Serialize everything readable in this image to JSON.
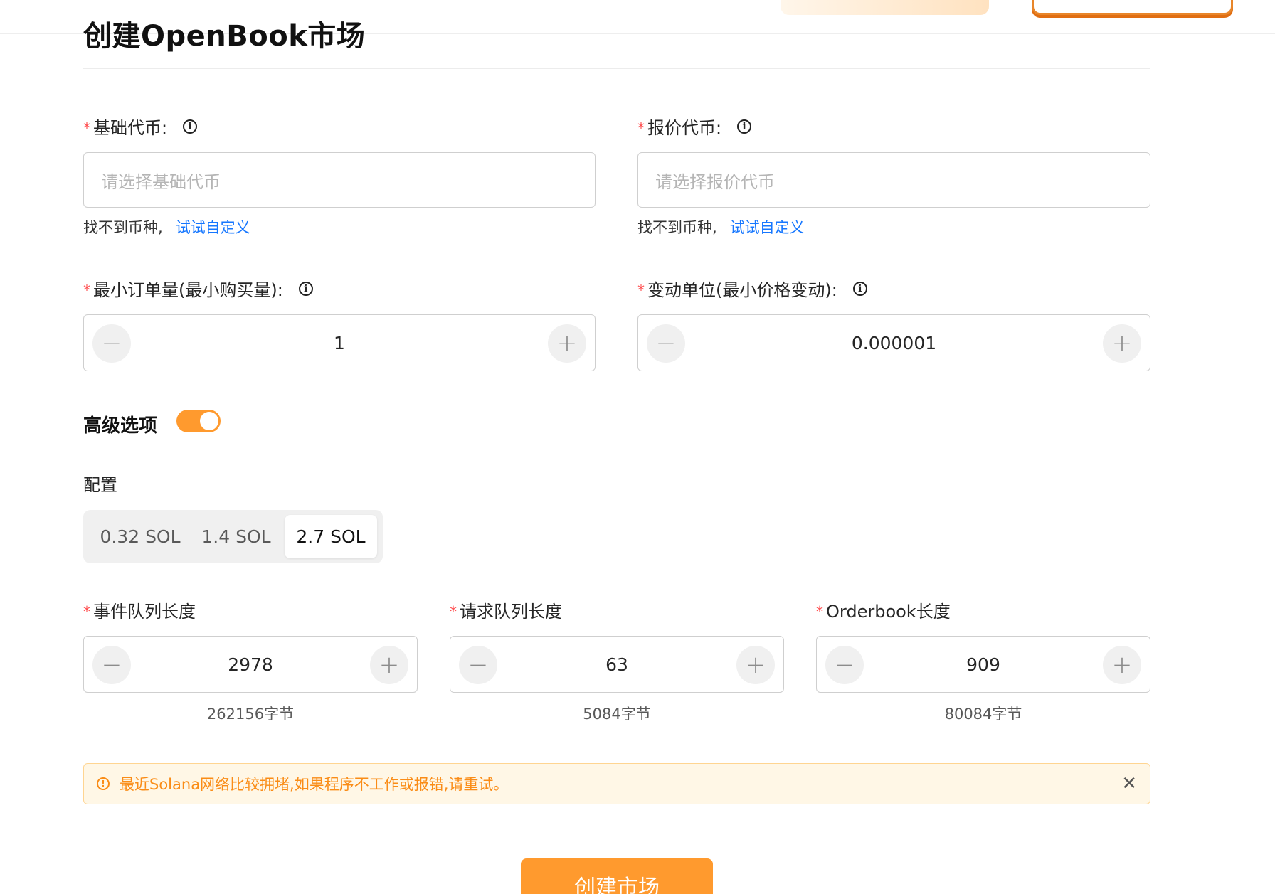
{
  "page": {
    "title": "创建OpenBook市场"
  },
  "base_token": {
    "label": "基础代币:",
    "placeholder": "请选择基础代币",
    "hint": "找不到币种,",
    "hint_link": "试试自定义"
  },
  "quote_token": {
    "label": "报价代币:",
    "placeholder": "请选择报价代币",
    "hint": "找不到币种,",
    "hint_link": "试试自定义"
  },
  "min_order": {
    "label": "最小订单量(最小购买量):",
    "value": "1"
  },
  "tick_size": {
    "label": "变动单位(最小价格变动):",
    "value": "0.000001"
  },
  "advanced": {
    "label": "高级选项",
    "enabled": true
  },
  "config": {
    "label": "配置",
    "options": [
      "0.32 SOL",
      "1.4 SOL",
      "2.7 SOL"
    ],
    "selected": "2.7 SOL"
  },
  "event_queue": {
    "label": "事件队列长度",
    "value": "2978",
    "bytes": "262156字节"
  },
  "request_queue": {
    "label": "请求队列长度",
    "value": "63",
    "bytes": "5084字节"
  },
  "orderbook": {
    "label": "Orderbook长度",
    "value": "909",
    "bytes": "80084字节"
  },
  "alert": {
    "message": "最近Solana网络比较拥堵,如果程序不工作或报错,请重试。"
  },
  "submit": {
    "label": "创建市场"
  },
  "colors": {
    "accent": "#ff9a2e",
    "link": "#1677ff",
    "required": "#ff4d4f",
    "warning": "#fa8c16"
  }
}
